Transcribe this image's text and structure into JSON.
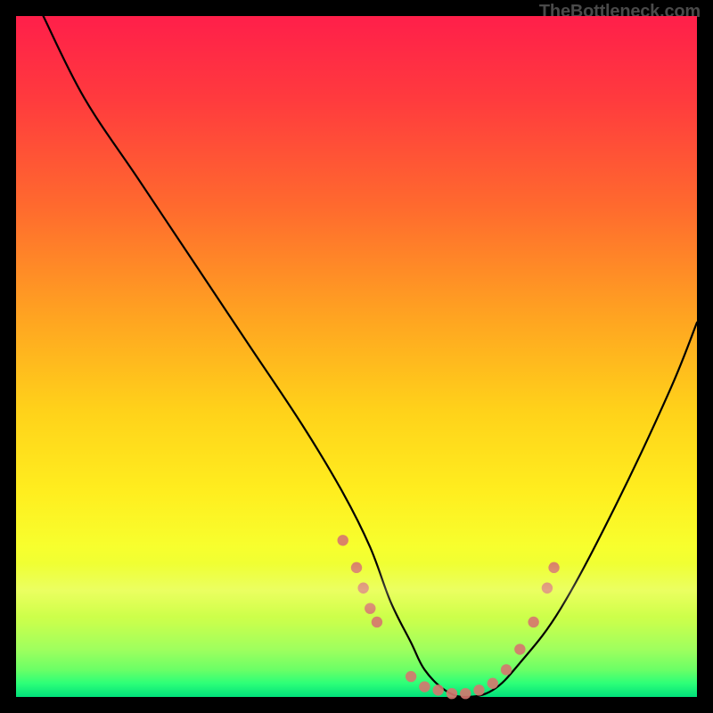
{
  "watermark": "TheBottleneck.com",
  "chart_data": {
    "type": "line",
    "title": "",
    "xlabel": "",
    "ylabel": "",
    "xlim": [
      0,
      100
    ],
    "ylim": [
      0,
      100
    ],
    "series": [
      {
        "name": "bottleneck-curve",
        "x": [
          4,
          10,
          18,
          26,
          34,
          42,
          48,
          52,
          55,
          58,
          60,
          63,
          66,
          70,
          74,
          80,
          88,
          96,
          100
        ],
        "y": [
          100,
          88,
          76,
          64,
          52,
          40,
          30,
          22,
          14,
          8,
          4,
          1,
          0,
          1,
          5,
          13,
          28,
          45,
          55
        ]
      }
    ],
    "markers": {
      "name": "highlighted-points",
      "color": "#d6756f",
      "points": [
        {
          "x": 48,
          "y": 23
        },
        {
          "x": 50,
          "y": 19
        },
        {
          "x": 51,
          "y": 16
        },
        {
          "x": 52,
          "y": 13
        },
        {
          "x": 53,
          "y": 11
        },
        {
          "x": 58,
          "y": 3
        },
        {
          "x": 60,
          "y": 1.5
        },
        {
          "x": 62,
          "y": 1
        },
        {
          "x": 64,
          "y": 0.5
        },
        {
          "x": 66,
          "y": 0.5
        },
        {
          "x": 68,
          "y": 1
        },
        {
          "x": 70,
          "y": 2
        },
        {
          "x": 72,
          "y": 4
        },
        {
          "x": 74,
          "y": 7
        },
        {
          "x": 76,
          "y": 11
        },
        {
          "x": 78,
          "y": 16
        },
        {
          "x": 79,
          "y": 19
        }
      ]
    }
  }
}
